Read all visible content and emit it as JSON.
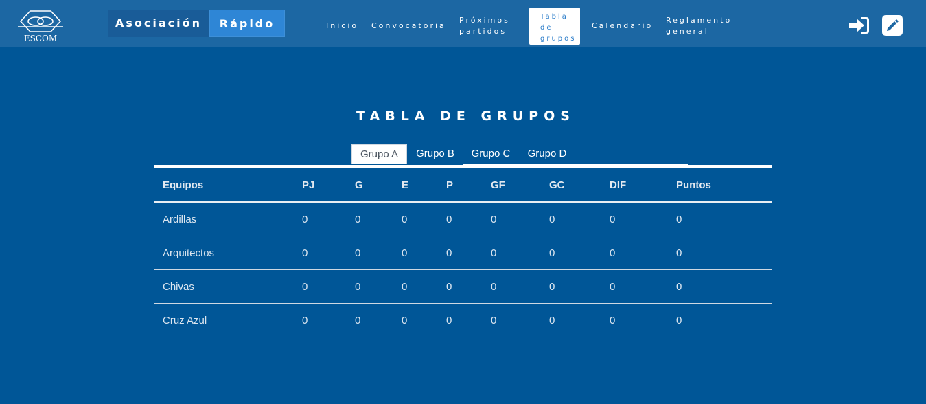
{
  "header": {
    "logo_text": "ESCOM",
    "brand_primary": "Asociación",
    "brand_secondary": "Rápido",
    "nav": [
      {
        "label": "Inicio"
      },
      {
        "label": "Convocatoria"
      },
      {
        "label_line1": "Próximos",
        "label_line2": "partidos"
      },
      {
        "label_line1": "Tabla",
        "label_line2": "de",
        "label_line3": "grupos",
        "active": true
      },
      {
        "label": "Calendario"
      },
      {
        "label_line1": "Reglamento",
        "label_line2": "general"
      }
    ],
    "actions": [
      {
        "icon": "sign-in-icon"
      },
      {
        "icon": "pencil-square-icon"
      }
    ]
  },
  "main": {
    "title": "TABLA DE GRUPOS",
    "tabs": [
      {
        "label": "Grupo A",
        "active": true
      },
      {
        "label": "Grupo B"
      },
      {
        "label": "Grupo C"
      },
      {
        "label": "Grupo D"
      }
    ],
    "table": {
      "columns": [
        "Equipos",
        "PJ",
        "G",
        "E",
        "P",
        "GF",
        "GC",
        "DIF",
        "Puntos"
      ],
      "rows": [
        [
          "Ardillas",
          "0",
          "0",
          "0",
          "0",
          "0",
          "0",
          "0",
          "0"
        ],
        [
          "Arquitectos",
          "0",
          "0",
          "0",
          "0",
          "0",
          "0",
          "0",
          "0"
        ],
        [
          "Chivas",
          "0",
          "0",
          "0",
          "0",
          "0",
          "0",
          "0",
          "0"
        ],
        [
          "Cruz Azul",
          "0",
          "0",
          "0",
          "0",
          "0",
          "0",
          "0",
          "0"
        ]
      ]
    }
  },
  "colors": {
    "background": "#005697",
    "header": "#1c67a3",
    "accent": "#2e86d6",
    "active_nav_text": "#2a7cc9"
  }
}
